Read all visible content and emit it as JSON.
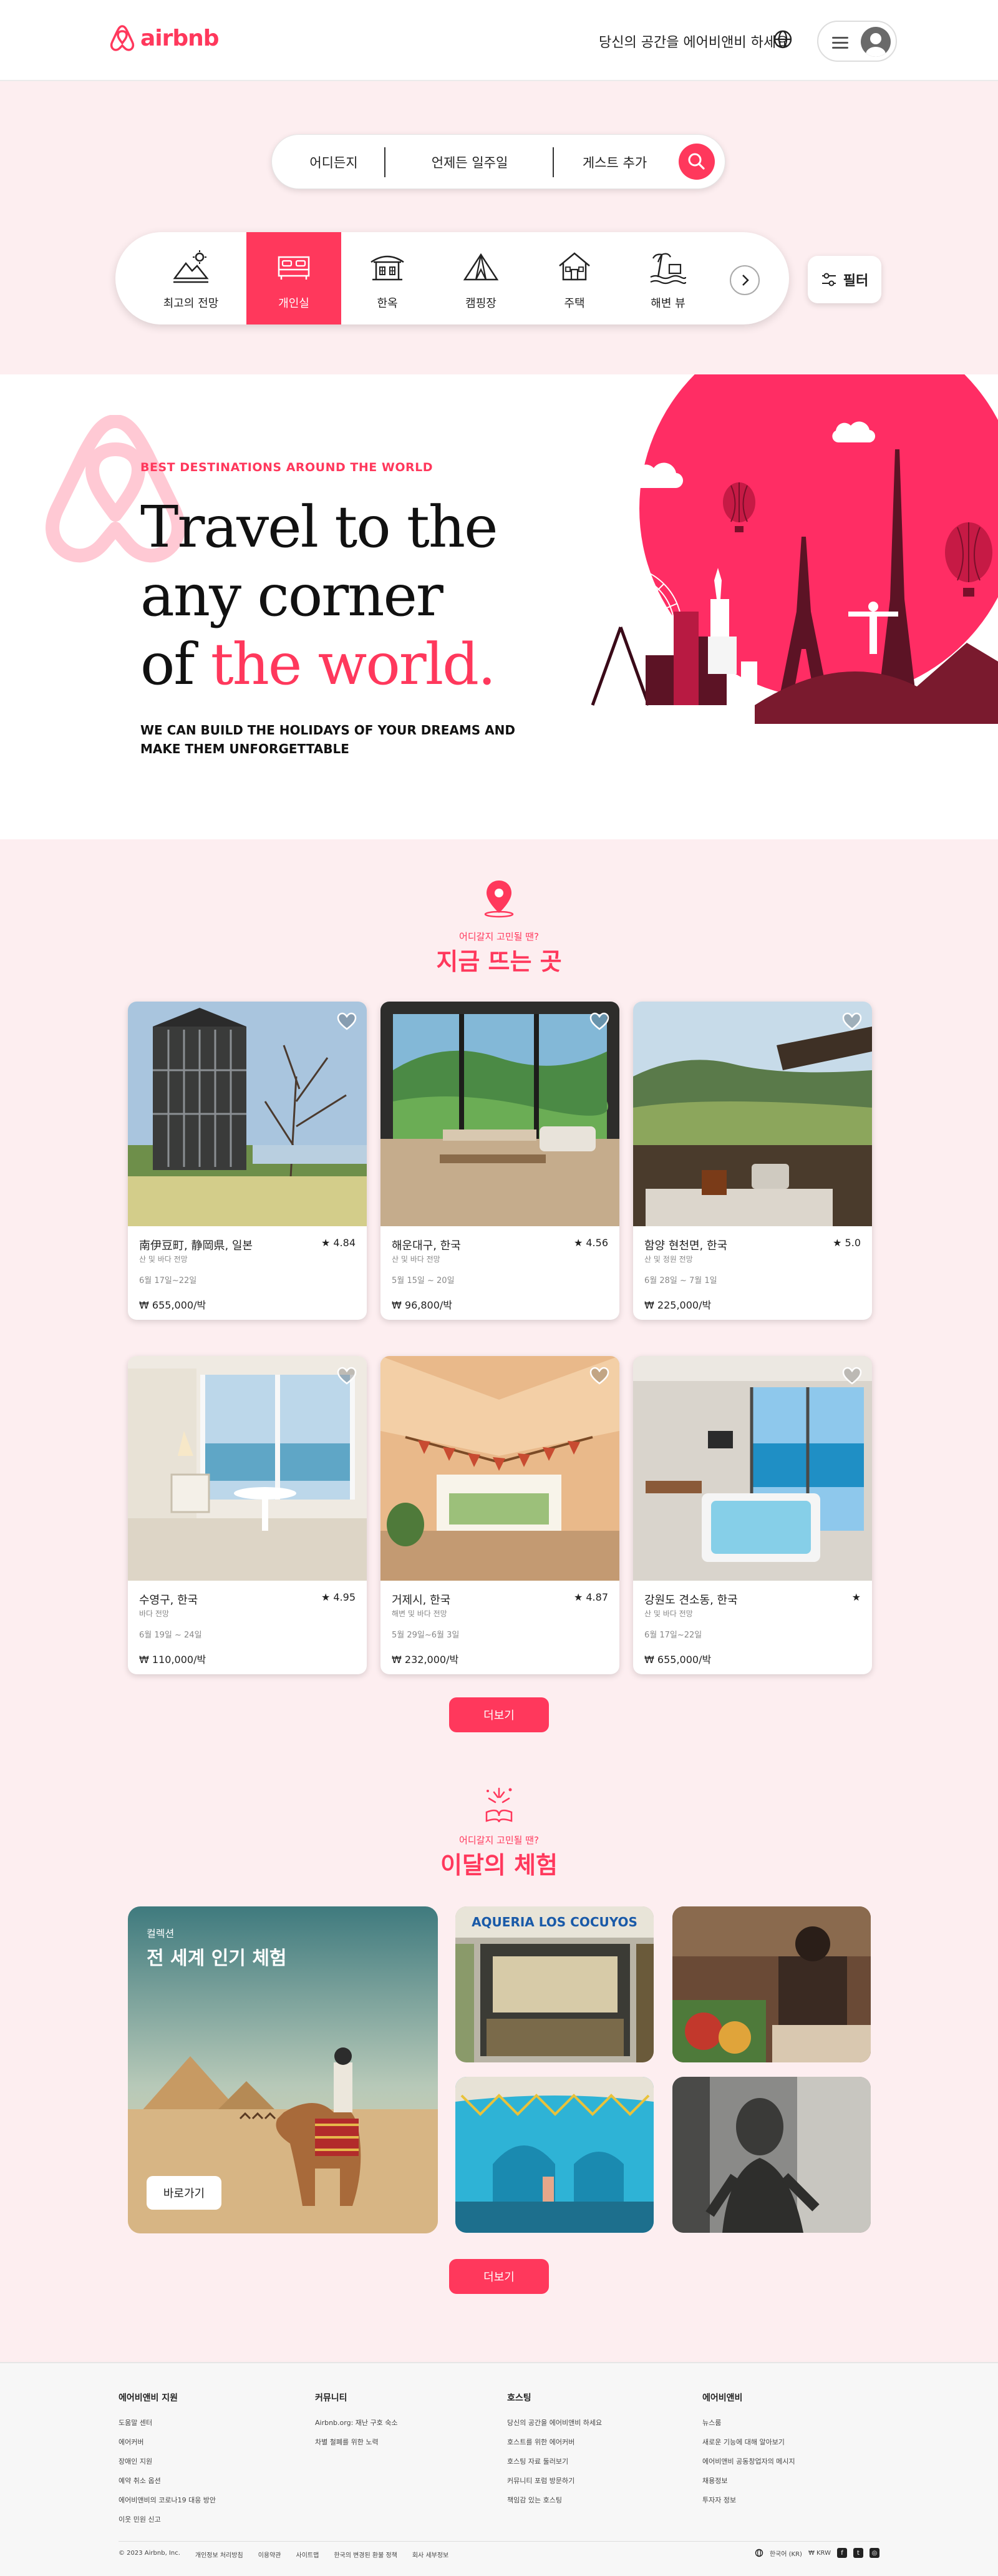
{
  "header": {
    "logo_text": "airbnb",
    "host_link": "당신의 공간을 에어비앤비 하세요",
    "icons": {
      "globe": "globe-icon",
      "menu": "hamburger-icon",
      "avatar": "user-avatar-icon"
    }
  },
  "search": {
    "where": "어디든지",
    "when": "언제든 일주일",
    "guests": "게스트 추가",
    "button_icon": "search-icon"
  },
  "categories": [
    {
      "label": "최고의 전망",
      "icon": "mountain-view-icon",
      "active": false
    },
    {
      "label": "개인실",
      "icon": "bed-icon",
      "active": true
    },
    {
      "label": "한옥",
      "icon": "hanok-icon",
      "active": false
    },
    {
      "label": "캠핑장",
      "icon": "tent-icon",
      "active": false
    },
    {
      "label": "주택",
      "icon": "house-icon",
      "active": false
    },
    {
      "label": "해변 뷰",
      "icon": "beach-icon",
      "active": false
    }
  ],
  "filter_label": "필터",
  "hero": {
    "kicker": "BEST DESTINATIONS AROUND THE WORLD",
    "line1": "Travel to the",
    "line2": "any corner",
    "line3_prefix": "of ",
    "line3_accent": "the world.",
    "subtitle": "WE CAN BUILD THE HOLIDAYS OF YOUR DREAMS AND MAKE THEM UNFORGETTABLE"
  },
  "stays": {
    "kicker": "어디갈지 고민될 땐?",
    "title": "지금 뜨는 곳",
    "cards": [
      {
        "title": "南伊豆町, 静岡県, 일본",
        "rating": "★ 4.84",
        "desc": "산 및 바다 전망",
        "dates": "6월 17일~22일",
        "price": "₩ 655,000/박"
      },
      {
        "title": "해운대구, 한국",
        "rating": "★ 4.56",
        "desc": "산 및 바다 전망",
        "dates": "5월 15일 ~ 20일",
        "price": "₩ 96,800/박"
      },
      {
        "title": "함양 현천면, 한국",
        "rating": "★ 5.0",
        "desc": "산 및 정원 전망",
        "dates": "6월 28일 ~ 7월 1일",
        "price": "₩ 225,000/박"
      },
      {
        "title": "수영구, 한국",
        "rating": "★ 4.95",
        "desc": "바다 전망",
        "dates": "6월 19일 ~ 24일",
        "price": "₩ 110,000/박"
      },
      {
        "title": "거제시, 한국",
        "rating": "★ 4.87",
        "desc": "해변 및 바다 전망",
        "dates": "5월 29일~6월 3일",
        "price": "₩ 232,000/박"
      },
      {
        "title": "강원도 견소동, 한국",
        "rating": "★",
        "desc": "산 및 바다 전망",
        "dates": "6월 17일~22일",
        "price": "₩ 655,000/박"
      }
    ],
    "more": "더보기"
  },
  "experiences": {
    "kicker": "어디갈지 고민될 땐?",
    "title": "이달의 체험",
    "feature_kicker": "컬렉션",
    "feature_title": "전 세계 인기 체험",
    "feature_button": "바로가기",
    "taqueria_sign": "AQUERIA LOS COCUYOS",
    "more": "더보기"
  },
  "footer": {
    "columns": [
      {
        "title": "에어비앤비 지원",
        "items": [
          "도움말 센터",
          "에어커버",
          "장애인 지원",
          "예약 취소 옵션",
          "에어비앤비의 코로나19 대응 방안",
          "이웃 민원 신고"
        ]
      },
      {
        "title": "커뮤니티",
        "items": [
          "Airbnb.org: 재난 구호 숙소",
          "차별 철폐를 위한 노력"
        ]
      },
      {
        "title": "호스팅",
        "items": [
          "당신의 공간을 에어비앤비 하세요",
          "호스트를 위한 에어커버",
          "호스팅 자료 둘러보기",
          "커뮤니티 포럼 방문하기",
          "책임감 있는 호스팅"
        ]
      },
      {
        "title": "에어비앤비",
        "items": [
          "뉴스룸",
          "새로운 기능에 대해 알아보기",
          "에어비앤비 공동창업자의 메시지",
          "채용정보",
          "투자자 정보"
        ]
      }
    ],
    "copyright": "© 2023 Airbnb, Inc.",
    "legal": [
      "개인정보 처리방침",
      "이용약관",
      "사이트맵",
      "한국의 변경된 환불 정책",
      "회사 세부정보"
    ],
    "language": "한국어 (KR)",
    "currency": "₩ KRW"
  },
  "colors": {
    "brand": "#ff385c",
    "bg_pink": "#fdeef0"
  }
}
